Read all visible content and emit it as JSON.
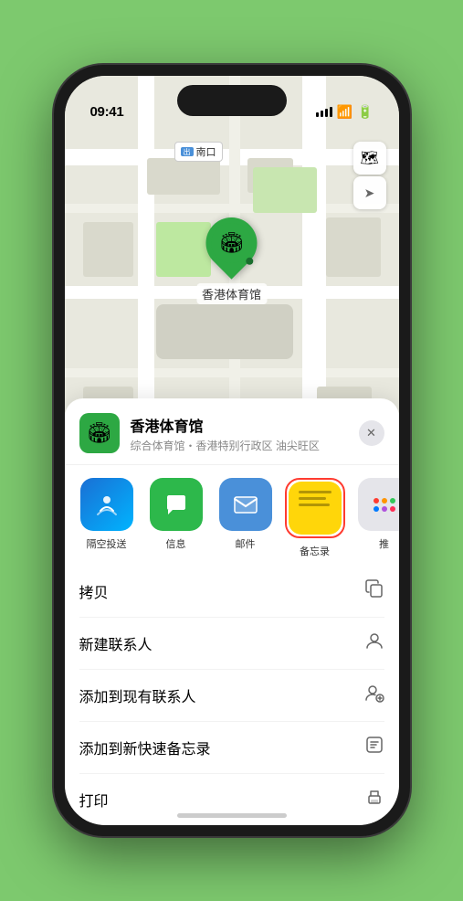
{
  "status_bar": {
    "time": "09:41",
    "location_icon": "▶",
    "signal_label": "signal",
    "wifi_label": "wifi",
    "battery_label": "battery"
  },
  "map": {
    "label_chip_text": "南口",
    "label_chip_prefix": "出",
    "stadium_name": "香港体育馆",
    "controls": {
      "map_type": "🗺",
      "location": "➤"
    }
  },
  "venue_card": {
    "icon": "🏟",
    "name": "香港体育馆",
    "subtitle": "综合体育馆・香港特别行政区 油尖旺区",
    "close_icon": "✕"
  },
  "share_actions": [
    {
      "id": "airdrop",
      "label": "隔空投送",
      "bg_class": "airdrop",
      "selected": false
    },
    {
      "id": "messages",
      "label": "信息",
      "bg_class": "messages",
      "selected": false
    },
    {
      "id": "mail",
      "label": "邮件",
      "bg_class": "mail",
      "selected": false
    },
    {
      "id": "notes",
      "label": "备忘录",
      "bg_class": "notes",
      "selected": true
    }
  ],
  "action_items": [
    {
      "label": "拷贝",
      "icon": "copy"
    },
    {
      "label": "新建联系人",
      "icon": "person"
    },
    {
      "label": "添加到现有联系人",
      "icon": "person-add"
    },
    {
      "label": "添加到新快速备忘录",
      "icon": "note"
    },
    {
      "label": "打印",
      "icon": "print"
    }
  ],
  "more_dots": {
    "colors": [
      "#ff3b30",
      "#ff9500",
      "#34c759",
      "#007aff",
      "#af52de",
      "#ff2d55"
    ]
  }
}
